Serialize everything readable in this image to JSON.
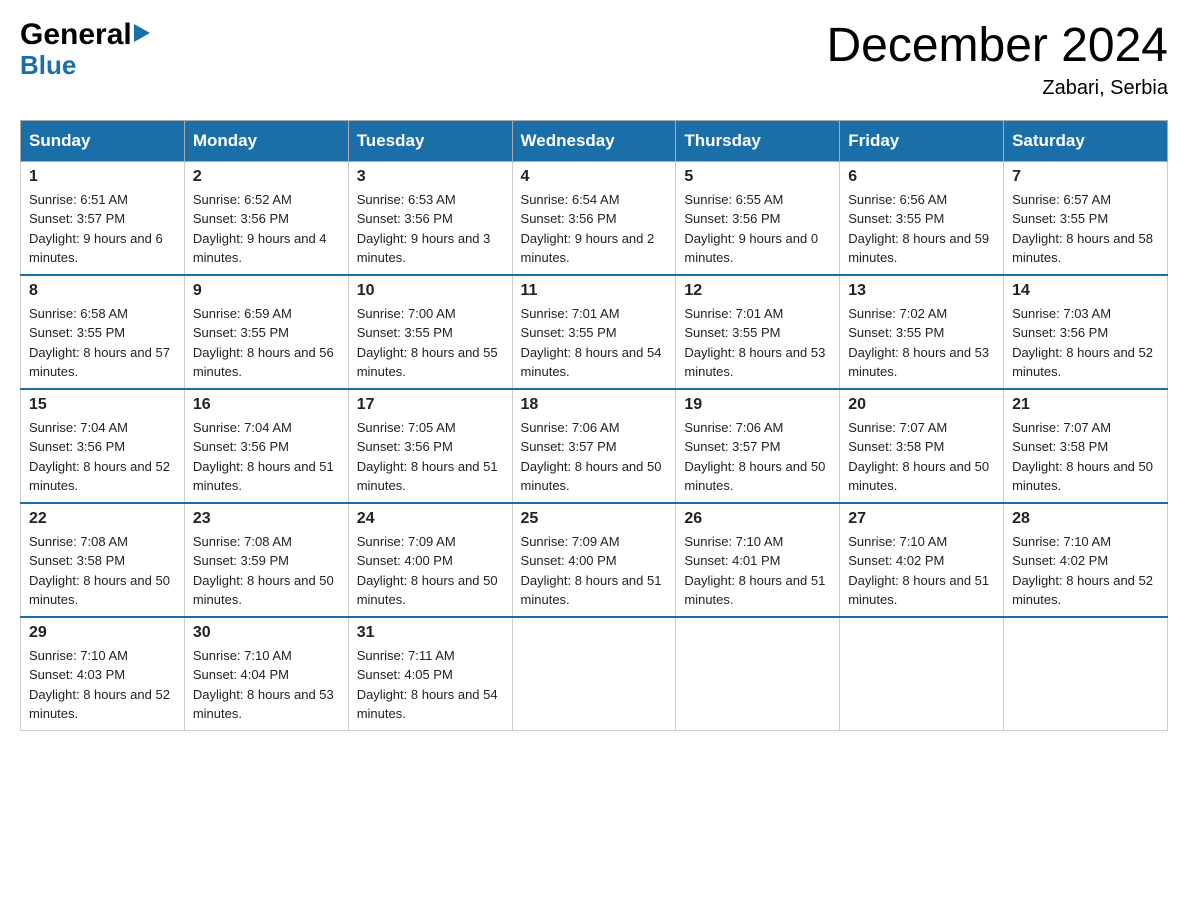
{
  "header": {
    "logo_general": "General",
    "logo_blue": "Blue",
    "title": "December 2024",
    "location": "Zabari, Serbia"
  },
  "days_of_week": [
    "Sunday",
    "Monday",
    "Tuesday",
    "Wednesday",
    "Thursday",
    "Friday",
    "Saturday"
  ],
  "weeks": [
    [
      {
        "day": "1",
        "sunrise": "6:51 AM",
        "sunset": "3:57 PM",
        "daylight": "9 hours and 6 minutes."
      },
      {
        "day": "2",
        "sunrise": "6:52 AM",
        "sunset": "3:56 PM",
        "daylight": "9 hours and 4 minutes."
      },
      {
        "day": "3",
        "sunrise": "6:53 AM",
        "sunset": "3:56 PM",
        "daylight": "9 hours and 3 minutes."
      },
      {
        "day": "4",
        "sunrise": "6:54 AM",
        "sunset": "3:56 PM",
        "daylight": "9 hours and 2 minutes."
      },
      {
        "day": "5",
        "sunrise": "6:55 AM",
        "sunset": "3:56 PM",
        "daylight": "9 hours and 0 minutes."
      },
      {
        "day": "6",
        "sunrise": "6:56 AM",
        "sunset": "3:55 PM",
        "daylight": "8 hours and 59 minutes."
      },
      {
        "day": "7",
        "sunrise": "6:57 AM",
        "sunset": "3:55 PM",
        "daylight": "8 hours and 58 minutes."
      }
    ],
    [
      {
        "day": "8",
        "sunrise": "6:58 AM",
        "sunset": "3:55 PM",
        "daylight": "8 hours and 57 minutes."
      },
      {
        "day": "9",
        "sunrise": "6:59 AM",
        "sunset": "3:55 PM",
        "daylight": "8 hours and 56 minutes."
      },
      {
        "day": "10",
        "sunrise": "7:00 AM",
        "sunset": "3:55 PM",
        "daylight": "8 hours and 55 minutes."
      },
      {
        "day": "11",
        "sunrise": "7:01 AM",
        "sunset": "3:55 PM",
        "daylight": "8 hours and 54 minutes."
      },
      {
        "day": "12",
        "sunrise": "7:01 AM",
        "sunset": "3:55 PM",
        "daylight": "8 hours and 53 minutes."
      },
      {
        "day": "13",
        "sunrise": "7:02 AM",
        "sunset": "3:55 PM",
        "daylight": "8 hours and 53 minutes."
      },
      {
        "day": "14",
        "sunrise": "7:03 AM",
        "sunset": "3:56 PM",
        "daylight": "8 hours and 52 minutes."
      }
    ],
    [
      {
        "day": "15",
        "sunrise": "7:04 AM",
        "sunset": "3:56 PM",
        "daylight": "8 hours and 52 minutes."
      },
      {
        "day": "16",
        "sunrise": "7:04 AM",
        "sunset": "3:56 PM",
        "daylight": "8 hours and 51 minutes."
      },
      {
        "day": "17",
        "sunrise": "7:05 AM",
        "sunset": "3:56 PM",
        "daylight": "8 hours and 51 minutes."
      },
      {
        "day": "18",
        "sunrise": "7:06 AM",
        "sunset": "3:57 PM",
        "daylight": "8 hours and 50 minutes."
      },
      {
        "day": "19",
        "sunrise": "7:06 AM",
        "sunset": "3:57 PM",
        "daylight": "8 hours and 50 minutes."
      },
      {
        "day": "20",
        "sunrise": "7:07 AM",
        "sunset": "3:58 PM",
        "daylight": "8 hours and 50 minutes."
      },
      {
        "day": "21",
        "sunrise": "7:07 AM",
        "sunset": "3:58 PM",
        "daylight": "8 hours and 50 minutes."
      }
    ],
    [
      {
        "day": "22",
        "sunrise": "7:08 AM",
        "sunset": "3:58 PM",
        "daylight": "8 hours and 50 minutes."
      },
      {
        "day": "23",
        "sunrise": "7:08 AM",
        "sunset": "3:59 PM",
        "daylight": "8 hours and 50 minutes."
      },
      {
        "day": "24",
        "sunrise": "7:09 AM",
        "sunset": "4:00 PM",
        "daylight": "8 hours and 50 minutes."
      },
      {
        "day": "25",
        "sunrise": "7:09 AM",
        "sunset": "4:00 PM",
        "daylight": "8 hours and 51 minutes."
      },
      {
        "day": "26",
        "sunrise": "7:10 AM",
        "sunset": "4:01 PM",
        "daylight": "8 hours and 51 minutes."
      },
      {
        "day": "27",
        "sunrise": "7:10 AM",
        "sunset": "4:02 PM",
        "daylight": "8 hours and 51 minutes."
      },
      {
        "day": "28",
        "sunrise": "7:10 AM",
        "sunset": "4:02 PM",
        "daylight": "8 hours and 52 minutes."
      }
    ],
    [
      {
        "day": "29",
        "sunrise": "7:10 AM",
        "sunset": "4:03 PM",
        "daylight": "8 hours and 52 minutes."
      },
      {
        "day": "30",
        "sunrise": "7:10 AM",
        "sunset": "4:04 PM",
        "daylight": "8 hours and 53 minutes."
      },
      {
        "day": "31",
        "sunrise": "7:11 AM",
        "sunset": "4:05 PM",
        "daylight": "8 hours and 54 minutes."
      },
      null,
      null,
      null,
      null
    ]
  ]
}
